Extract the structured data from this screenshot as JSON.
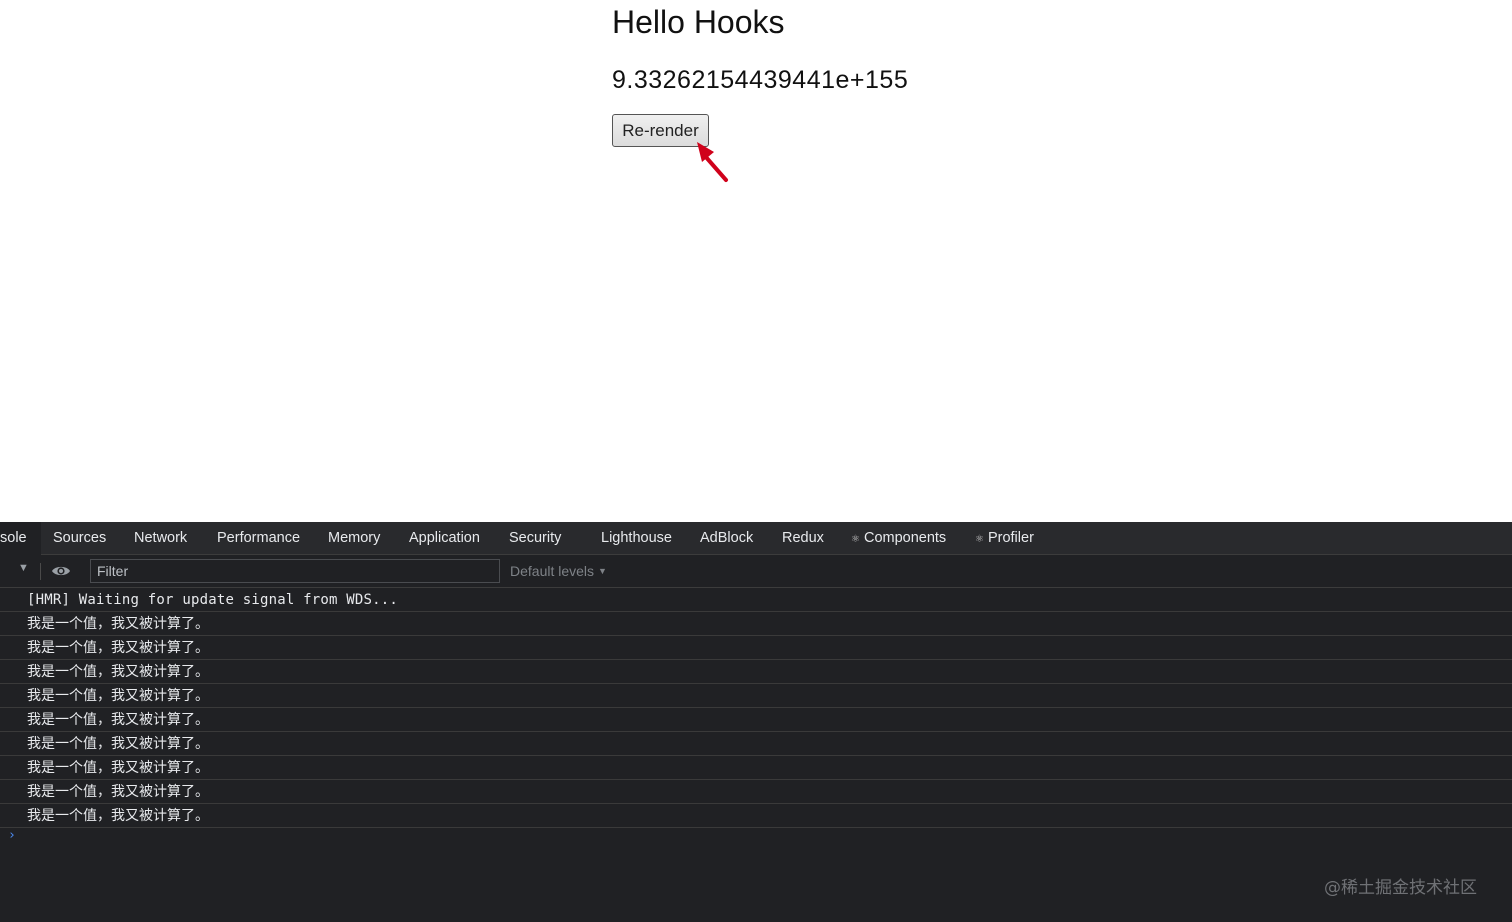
{
  "page": {
    "heading": "Hello Hooks",
    "computed_value": "9.33262154439441e+155",
    "rerender_label": "Re-render"
  },
  "devtools": {
    "tabs": [
      {
        "label": "sole",
        "active": true
      },
      {
        "label": "Sources"
      },
      {
        "label": "Network"
      },
      {
        "label": "Performance"
      },
      {
        "label": "Memory"
      },
      {
        "label": "Application"
      },
      {
        "label": "Security"
      },
      {
        "label": "Lighthouse"
      },
      {
        "label": "AdBlock"
      },
      {
        "label": "Redux"
      },
      {
        "label": "Components",
        "icon": "react-atom-icon"
      },
      {
        "label": "Profiler",
        "icon": "react-atom-icon"
      }
    ],
    "filter_placeholder": "Filter",
    "levels_label": "Default levels",
    "console_lines": [
      "[HMR] Waiting for update signal from WDS...",
      "我是一个值，我又被计算了。",
      "我是一个值，我又被计算了。",
      "我是一个值，我又被计算了。",
      "我是一个值，我又被计算了。",
      "我是一个值，我又被计算了。",
      "我是一个值，我又被计算了。",
      "我是一个值，我又被计算了。",
      "我是一个值，我又被计算了。",
      "我是一个值，我又被计算了。"
    ],
    "prompt_symbol": "›"
  },
  "watermark": "@稀土掘金技术社区",
  "colors": {
    "devtools_bg": "#202124",
    "annotation_arrow": "#d0021b",
    "prompt": "#4c8df6"
  }
}
